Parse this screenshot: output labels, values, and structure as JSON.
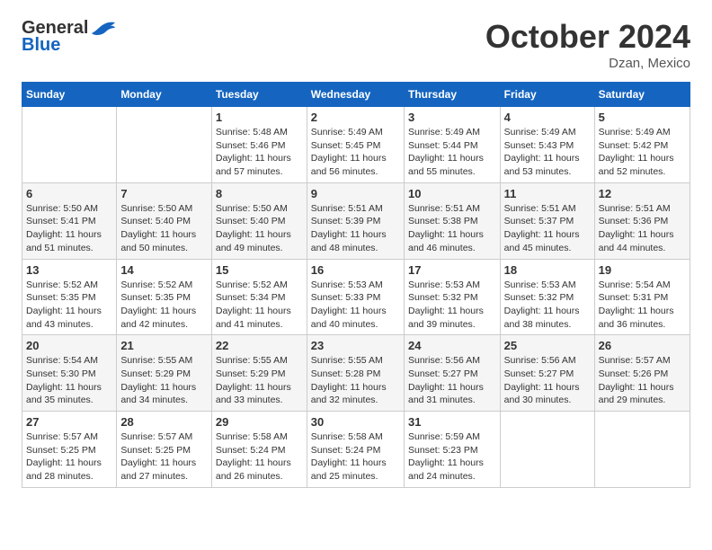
{
  "logo": {
    "general": "General",
    "blue": "Blue"
  },
  "header": {
    "title": "October 2024",
    "subtitle": "Dzan, Mexico"
  },
  "weekdays": [
    "Sunday",
    "Monday",
    "Tuesday",
    "Wednesday",
    "Thursday",
    "Friday",
    "Saturday"
  ],
  "weeks": [
    [
      {
        "day": "",
        "info": ""
      },
      {
        "day": "",
        "info": ""
      },
      {
        "day": "1",
        "info": "Sunrise: 5:48 AM\nSunset: 5:46 PM\nDaylight: 11 hours and 57 minutes."
      },
      {
        "day": "2",
        "info": "Sunrise: 5:49 AM\nSunset: 5:45 PM\nDaylight: 11 hours and 56 minutes."
      },
      {
        "day": "3",
        "info": "Sunrise: 5:49 AM\nSunset: 5:44 PM\nDaylight: 11 hours and 55 minutes."
      },
      {
        "day": "4",
        "info": "Sunrise: 5:49 AM\nSunset: 5:43 PM\nDaylight: 11 hours and 53 minutes."
      },
      {
        "day": "5",
        "info": "Sunrise: 5:49 AM\nSunset: 5:42 PM\nDaylight: 11 hours and 52 minutes."
      }
    ],
    [
      {
        "day": "6",
        "info": "Sunrise: 5:50 AM\nSunset: 5:41 PM\nDaylight: 11 hours and 51 minutes."
      },
      {
        "day": "7",
        "info": "Sunrise: 5:50 AM\nSunset: 5:40 PM\nDaylight: 11 hours and 50 minutes."
      },
      {
        "day": "8",
        "info": "Sunrise: 5:50 AM\nSunset: 5:40 PM\nDaylight: 11 hours and 49 minutes."
      },
      {
        "day": "9",
        "info": "Sunrise: 5:51 AM\nSunset: 5:39 PM\nDaylight: 11 hours and 48 minutes."
      },
      {
        "day": "10",
        "info": "Sunrise: 5:51 AM\nSunset: 5:38 PM\nDaylight: 11 hours and 46 minutes."
      },
      {
        "day": "11",
        "info": "Sunrise: 5:51 AM\nSunset: 5:37 PM\nDaylight: 11 hours and 45 minutes."
      },
      {
        "day": "12",
        "info": "Sunrise: 5:51 AM\nSunset: 5:36 PM\nDaylight: 11 hours and 44 minutes."
      }
    ],
    [
      {
        "day": "13",
        "info": "Sunrise: 5:52 AM\nSunset: 5:35 PM\nDaylight: 11 hours and 43 minutes."
      },
      {
        "day": "14",
        "info": "Sunrise: 5:52 AM\nSunset: 5:35 PM\nDaylight: 11 hours and 42 minutes."
      },
      {
        "day": "15",
        "info": "Sunrise: 5:52 AM\nSunset: 5:34 PM\nDaylight: 11 hours and 41 minutes."
      },
      {
        "day": "16",
        "info": "Sunrise: 5:53 AM\nSunset: 5:33 PM\nDaylight: 11 hours and 40 minutes."
      },
      {
        "day": "17",
        "info": "Sunrise: 5:53 AM\nSunset: 5:32 PM\nDaylight: 11 hours and 39 minutes."
      },
      {
        "day": "18",
        "info": "Sunrise: 5:53 AM\nSunset: 5:32 PM\nDaylight: 11 hours and 38 minutes."
      },
      {
        "day": "19",
        "info": "Sunrise: 5:54 AM\nSunset: 5:31 PM\nDaylight: 11 hours and 36 minutes."
      }
    ],
    [
      {
        "day": "20",
        "info": "Sunrise: 5:54 AM\nSunset: 5:30 PM\nDaylight: 11 hours and 35 minutes."
      },
      {
        "day": "21",
        "info": "Sunrise: 5:55 AM\nSunset: 5:29 PM\nDaylight: 11 hours and 34 minutes."
      },
      {
        "day": "22",
        "info": "Sunrise: 5:55 AM\nSunset: 5:29 PM\nDaylight: 11 hours and 33 minutes."
      },
      {
        "day": "23",
        "info": "Sunrise: 5:55 AM\nSunset: 5:28 PM\nDaylight: 11 hours and 32 minutes."
      },
      {
        "day": "24",
        "info": "Sunrise: 5:56 AM\nSunset: 5:27 PM\nDaylight: 11 hours and 31 minutes."
      },
      {
        "day": "25",
        "info": "Sunrise: 5:56 AM\nSunset: 5:27 PM\nDaylight: 11 hours and 30 minutes."
      },
      {
        "day": "26",
        "info": "Sunrise: 5:57 AM\nSunset: 5:26 PM\nDaylight: 11 hours and 29 minutes."
      }
    ],
    [
      {
        "day": "27",
        "info": "Sunrise: 5:57 AM\nSunset: 5:25 PM\nDaylight: 11 hours and 28 minutes."
      },
      {
        "day": "28",
        "info": "Sunrise: 5:57 AM\nSunset: 5:25 PM\nDaylight: 11 hours and 27 minutes."
      },
      {
        "day": "29",
        "info": "Sunrise: 5:58 AM\nSunset: 5:24 PM\nDaylight: 11 hours and 26 minutes."
      },
      {
        "day": "30",
        "info": "Sunrise: 5:58 AM\nSunset: 5:24 PM\nDaylight: 11 hours and 25 minutes."
      },
      {
        "day": "31",
        "info": "Sunrise: 5:59 AM\nSunset: 5:23 PM\nDaylight: 11 hours and 24 minutes."
      },
      {
        "day": "",
        "info": ""
      },
      {
        "day": "",
        "info": ""
      }
    ]
  ]
}
